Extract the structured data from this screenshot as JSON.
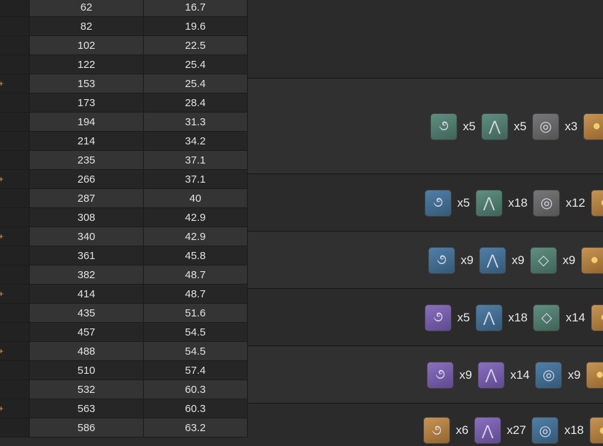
{
  "table": {
    "rows": [
      {
        "hp": "62",
        "atk": "16.7",
        "marker": ""
      },
      {
        "hp": "82",
        "atk": "19.6",
        "marker": ""
      },
      {
        "hp": "102",
        "atk": "22.5",
        "marker": ""
      },
      {
        "hp": "122",
        "atk": "25.4",
        "marker": ""
      },
      {
        "hp": "153",
        "atk": "25.4",
        "marker": "+"
      },
      {
        "hp": "173",
        "atk": "28.4",
        "marker": ""
      },
      {
        "hp": "194",
        "atk": "31.3",
        "marker": ""
      },
      {
        "hp": "214",
        "atk": "34.2",
        "marker": ""
      },
      {
        "hp": "235",
        "atk": "37.1",
        "marker": ""
      },
      {
        "hp": "266",
        "atk": "37.1",
        "marker": "+"
      },
      {
        "hp": "287",
        "atk": "40",
        "marker": ""
      },
      {
        "hp": "308",
        "atk": "42.9",
        "marker": ""
      },
      {
        "hp": "340",
        "atk": "42.9",
        "marker": "+"
      },
      {
        "hp": "361",
        "atk": "45.8",
        "marker": ""
      },
      {
        "hp": "382",
        "atk": "48.7",
        "marker": ""
      },
      {
        "hp": "414",
        "atk": "48.7",
        "marker": "+"
      },
      {
        "hp": "435",
        "atk": "51.6",
        "marker": ""
      },
      {
        "hp": "457",
        "atk": "54.5",
        "marker": ""
      },
      {
        "hp": "488",
        "atk": "54.5",
        "marker": "+"
      },
      {
        "hp": "510",
        "atk": "57.4",
        "marker": ""
      },
      {
        "hp": "532",
        "atk": "60.3",
        "marker": ""
      },
      {
        "hp": "563",
        "atk": "60.3",
        "marker": "+"
      },
      {
        "hp": "586",
        "atk": "63.2",
        "marker": ""
      }
    ]
  },
  "materials": [
    {
      "items": [
        {
          "icon": "brown-swirl-icon",
          "color": "green",
          "glyph": "૭",
          "qty": "x5"
        },
        {
          "icon": "claw-icon",
          "color": "green",
          "glyph": "⋀",
          "qty": "x5"
        },
        {
          "icon": "ring-icon",
          "color": "grey",
          "glyph": "◎",
          "qty": "x3"
        },
        {
          "icon": "coin-icon",
          "color": "gold",
          "glyph": "●",
          "qty": ""
        }
      ]
    },
    {
      "items": [
        {
          "icon": "dark-swirl-icon",
          "color": "blue",
          "glyph": "૭",
          "qty": "x5"
        },
        {
          "icon": "claw-icon",
          "color": "green",
          "glyph": "⋀",
          "qty": "x18"
        },
        {
          "icon": "ring-icon",
          "color": "grey",
          "glyph": "◎",
          "qty": "x12"
        },
        {
          "icon": "coin-icon",
          "color": "gold",
          "glyph": "●",
          "qty": ""
        }
      ]
    },
    {
      "items": [
        {
          "icon": "dark-swirl-icon",
          "color": "blue",
          "glyph": "૭",
          "qty": "x9"
        },
        {
          "icon": "claw-icon",
          "color": "blue",
          "glyph": "⋀",
          "qty": "x9"
        },
        {
          "icon": "crystal-ring-icon",
          "color": "green",
          "glyph": "◇",
          "qty": "x9"
        },
        {
          "icon": "coin-icon",
          "color": "gold",
          "glyph": "●",
          "qty": ""
        }
      ]
    },
    {
      "items": [
        {
          "icon": "light-swirl-icon",
          "color": "purple",
          "glyph": "૭",
          "qty": "x5"
        },
        {
          "icon": "claw-icon",
          "color": "blue",
          "glyph": "⋀",
          "qty": "x18"
        },
        {
          "icon": "crystal-ring-icon",
          "color": "green",
          "glyph": "◇",
          "qty": "x14"
        },
        {
          "icon": "coin-icon",
          "color": "gold",
          "glyph": "●",
          "qty": ""
        }
      ]
    },
    {
      "items": [
        {
          "icon": "light-swirl-icon",
          "color": "purple",
          "glyph": "૭",
          "qty": "x9"
        },
        {
          "icon": "claw-icon",
          "color": "purple",
          "glyph": "⋀",
          "qty": "x14"
        },
        {
          "icon": "gold-ring-icon",
          "color": "blue",
          "glyph": "◎",
          "qty": "x9"
        },
        {
          "icon": "coin-icon",
          "color": "gold",
          "glyph": "●",
          "qty": ""
        }
      ]
    },
    {
      "items": [
        {
          "icon": "gold-swirl-icon",
          "color": "gold",
          "glyph": "૭",
          "qty": "x6"
        },
        {
          "icon": "claw-icon",
          "color": "purple",
          "glyph": "⋀",
          "qty": "x27"
        },
        {
          "icon": "gold-ring-icon",
          "color": "blue",
          "glyph": "◎",
          "qty": "x18"
        },
        {
          "icon": "coin-icon",
          "color": "gold",
          "glyph": "●",
          "qty": ""
        }
      ]
    }
  ]
}
